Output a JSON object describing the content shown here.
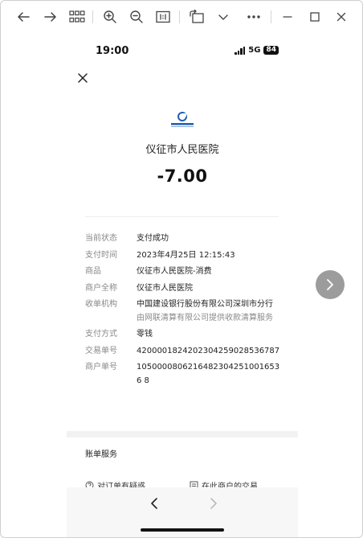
{
  "status": {
    "time": "19:00",
    "network": "5G",
    "battery": "84"
  },
  "payment": {
    "merchant_title": "仪征市人民医院",
    "amount": "-7.00",
    "rows": [
      {
        "label": "当前状态",
        "value": "支付成功"
      },
      {
        "label": "支付时间",
        "value": "2023年4月25日 12:15:43"
      },
      {
        "label": "商品",
        "value": "仪征市人民医院-消费"
      },
      {
        "label": "商户全称",
        "value": "仪征市人民医院"
      },
      {
        "label": "收单机构",
        "value": "中国建设银行股份有限公司深圳市分行",
        "sub": "由网联清算有限公司提供收款清算服务"
      },
      {
        "label": "支付方式",
        "value": "零钱"
      },
      {
        "label": "交易单号",
        "value": "4200001824202304259028536787"
      },
      {
        "label": "商户单号",
        "value": "10500008062164823042510016536 8"
      }
    ]
  },
  "bill_service": {
    "title": "账单服务",
    "link_question": "对订单有疑惑",
    "link_merchant": "在此商户的交易"
  },
  "colors": {
    "accent_blue": "#1d5fb0",
    "next_button": "#9c9c9c"
  }
}
